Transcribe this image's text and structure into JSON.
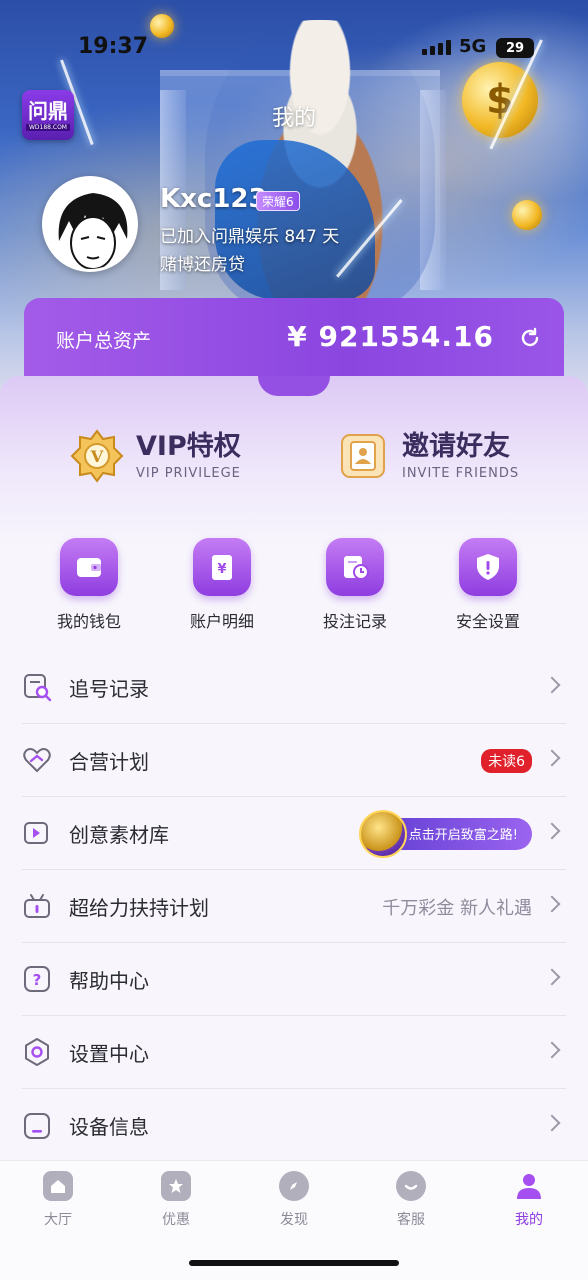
{
  "status_bar": {
    "time": "19:37",
    "network": "5G",
    "battery": "29"
  },
  "brand": {
    "logo_text": "问鼎",
    "logo_sub": "WD188.COM"
  },
  "header": {
    "title": "我的"
  },
  "profile": {
    "username": "Kxc123",
    "rank": "荣耀6",
    "joined": "已加入问鼎娱乐 847 天",
    "motto": "赌博还房贷"
  },
  "assets": {
    "label": "账户总资产",
    "value": "¥ 921554.16"
  },
  "promos": [
    {
      "title": "VIP特权",
      "subtitle": "VIP PRIVILEGE",
      "icon": "vip-icon"
    },
    {
      "title": "邀请好友",
      "subtitle": "INVITE FRIENDS",
      "icon": "invite-icon"
    }
  ],
  "quick_actions": [
    {
      "label": "我的钱包",
      "icon": "wallet-icon"
    },
    {
      "label": "账户明细",
      "icon": "statement-icon"
    },
    {
      "label": "投注记录",
      "icon": "bet-record-icon"
    },
    {
      "label": "安全设置",
      "icon": "shield-icon"
    }
  ],
  "menu": [
    {
      "label": "追号记录",
      "icon": "search-record-icon"
    },
    {
      "label": "合营计划",
      "icon": "partner-icon",
      "badge": "未读6"
    },
    {
      "label": "创意素材库",
      "icon": "video-icon",
      "banner": "点击开启致富之路!"
    },
    {
      "label": "超给力扶持计划",
      "icon": "gift-icon",
      "hint": "千万彩金 新人礼遇"
    },
    {
      "label": "帮助中心",
      "icon": "help-icon"
    },
    {
      "label": "设置中心",
      "icon": "gear-icon"
    },
    {
      "label": "设备信息",
      "icon": "device-icon"
    }
  ],
  "tabs": [
    {
      "label": "大厅",
      "icon": "home-icon",
      "active": false
    },
    {
      "label": "优惠",
      "icon": "star-icon",
      "active": false
    },
    {
      "label": "发现",
      "icon": "compass-icon",
      "active": false
    },
    {
      "label": "客服",
      "icon": "support-icon",
      "active": false
    },
    {
      "label": "我的",
      "icon": "user-icon",
      "active": true
    }
  ],
  "colors": {
    "accent": "#8f3de0",
    "unread": "#e0202a"
  }
}
